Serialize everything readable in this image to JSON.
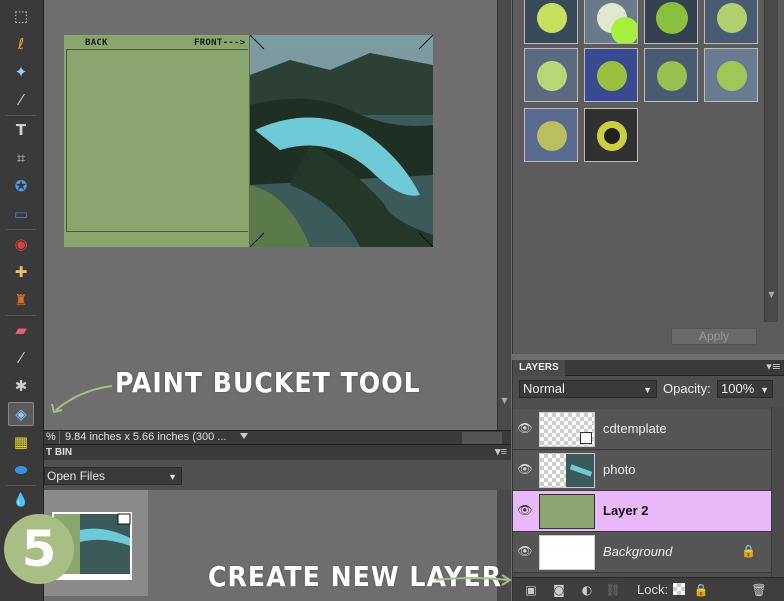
{
  "toolbar": {
    "tools": [
      {
        "name": "marquee-tool",
        "glyph": "⬚"
      },
      {
        "name": "lasso-tool",
        "glyph": "ℓ"
      },
      {
        "name": "magic-wand-tool",
        "glyph": "✦"
      },
      {
        "name": "quick-selection-tool",
        "glyph": "⁄"
      },
      {
        "name": "type-tool",
        "glyph": "T"
      },
      {
        "name": "crop-tool",
        "glyph": "⌗"
      },
      {
        "name": "cookie-cutter-tool",
        "glyph": "✪"
      },
      {
        "name": "straighten-tool",
        "glyph": "▭"
      },
      {
        "name": "red-eye-tool",
        "glyph": "◉"
      },
      {
        "name": "healing-brush-tool",
        "glyph": "✚"
      },
      {
        "name": "clone-stamp-tool",
        "glyph": "♜"
      },
      {
        "name": "eraser-tool",
        "glyph": "▰"
      },
      {
        "name": "brush-tool",
        "glyph": "⁄"
      },
      {
        "name": "smart-brush-tool",
        "glyph": "✱"
      },
      {
        "name": "paint-bucket-tool",
        "glyph": "◈"
      },
      {
        "name": "gradient-tool",
        "glyph": "▦"
      },
      {
        "name": "shape-tool",
        "glyph": "⬬"
      },
      {
        "name": "blur-tool",
        "glyph": "💧"
      }
    ]
  },
  "document": {
    "back_label": "BACK",
    "front_label": "FRONT--->"
  },
  "status": {
    "zoom_fragment": "%",
    "doc_size": "9.84 inches x 5.66 inches (300 ..."
  },
  "project_bin": {
    "title_fragment": "T BIN",
    "show_select": "Open Files"
  },
  "effects": {
    "apply_label": "Apply"
  },
  "layers": {
    "tab_label": "LAYERS",
    "blend_mode": "Normal",
    "opacity_label": "Opacity:",
    "opacity_value": "100%",
    "lock_label": "Lock:",
    "items": [
      {
        "name": "cdtemplate",
        "selected": false
      },
      {
        "name": "photo",
        "selected": false
      },
      {
        "name": "Layer 2",
        "selected": true
      },
      {
        "name": "Background",
        "selected": false,
        "locked": true
      }
    ]
  },
  "annotations": {
    "paint_bucket": "PAINT BUCKET TOOL",
    "create_layer": "CREATE NEW LAYER",
    "step_number": "5"
  },
  "colors": {
    "highlight": "#e8b8f8",
    "template_green": "#8ba56f",
    "annotation_green": "#a8be85"
  }
}
